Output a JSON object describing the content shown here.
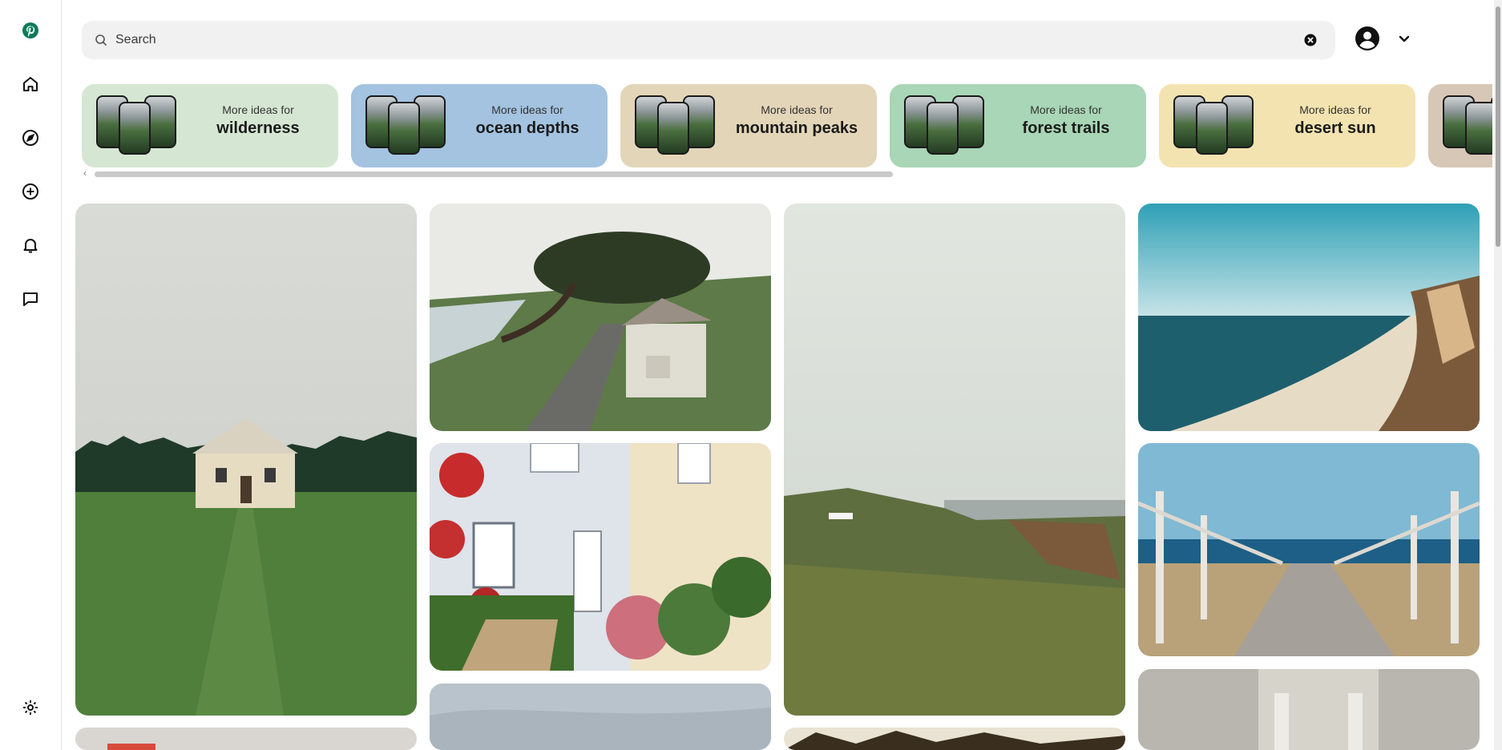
{
  "search": {
    "placeholder": "Search"
  },
  "nav": {
    "items": [
      {
        "name": "logo",
        "icon": "pinterest-logo-icon",
        "color": "#0e7a5a"
      },
      {
        "name": "home",
        "icon": "home-icon"
      },
      {
        "name": "explore",
        "icon": "compass-icon"
      },
      {
        "name": "create",
        "icon": "plus-circle-icon"
      },
      {
        "name": "notifications",
        "icon": "bell-icon"
      },
      {
        "name": "messages",
        "icon": "chat-icon"
      },
      {
        "name": "settings",
        "icon": "gear-icon"
      }
    ]
  },
  "ideas": [
    {
      "prefix": "More ideas for",
      "topic": "wilderness",
      "color": "#d5e7d2"
    },
    {
      "prefix": "More ideas for",
      "topic": "ocean depths",
      "color": "#a3c3e0"
    },
    {
      "prefix": "More ideas for",
      "topic": "mountain peaks",
      "color": "#e3d5b8"
    },
    {
      "prefix": "More ideas for",
      "topic": "forest trails",
      "color": "#a8d6b6"
    },
    {
      "prefix": "More ideas for",
      "topic": "desert sun",
      "color": "#f3e3b0"
    },
    {
      "prefix": "",
      "topic": "",
      "color": "#d7c7b6"
    }
  ],
  "pins": [
    {
      "subject": "white cottage in green field under grey sky"
    },
    {
      "subject": "wind-bent cypress tree and small shed on coastal path"
    },
    {
      "subject": "white cottage with red roses and garden furniture"
    },
    {
      "subject": "hazy coastal cliff with grassy meadow"
    },
    {
      "subject": "aerial view of sandy beach and sea cliff"
    },
    {
      "subject": "wooden boardwalk leading to the sea"
    },
    {
      "subject": "stone building doorway with columns"
    },
    {
      "subject": "pink and red image"
    },
    {
      "subject": "cloudy sky"
    },
    {
      "subject": "dark foliage"
    }
  ]
}
